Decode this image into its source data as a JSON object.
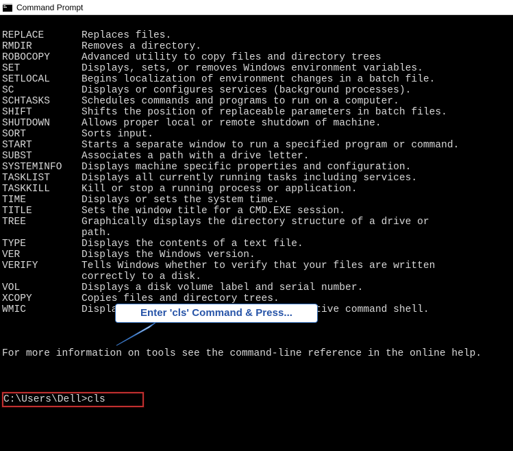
{
  "window": {
    "title": "Command Prompt"
  },
  "commands": [
    {
      "name": "REPLACE",
      "desc": "Replaces files."
    },
    {
      "name": "RMDIR",
      "desc": "Removes a directory."
    },
    {
      "name": "ROBOCOPY",
      "desc": "Advanced utility to copy files and directory trees"
    },
    {
      "name": "SET",
      "desc": "Displays, sets, or removes Windows environment variables."
    },
    {
      "name": "SETLOCAL",
      "desc": "Begins localization of environment changes in a batch file."
    },
    {
      "name": "SC",
      "desc": "Displays or configures services (background processes)."
    },
    {
      "name": "SCHTASKS",
      "desc": "Schedules commands and programs to run on a computer."
    },
    {
      "name": "SHIFT",
      "desc": "Shifts the position of replaceable parameters in batch files."
    },
    {
      "name": "SHUTDOWN",
      "desc": "Allows proper local or remote shutdown of machine."
    },
    {
      "name": "SORT",
      "desc": "Sorts input."
    },
    {
      "name": "START",
      "desc": "Starts a separate window to run a specified program or command."
    },
    {
      "name": "SUBST",
      "desc": "Associates a path with a drive letter."
    },
    {
      "name": "SYSTEMINFO",
      "desc": "Displays machine specific properties and configuration."
    },
    {
      "name": "TASKLIST",
      "desc": "Displays all currently running tasks including services."
    },
    {
      "name": "TASKKILL",
      "desc": "Kill or stop a running process or application."
    },
    {
      "name": "TIME",
      "desc": "Displays or sets the system time."
    },
    {
      "name": "TITLE",
      "desc": "Sets the window title for a CMD.EXE session."
    },
    {
      "name": "TREE",
      "desc": "Graphically displays the directory structure of a drive or",
      "cont": "path."
    },
    {
      "name": "TYPE",
      "desc": "Displays the contents of a text file."
    },
    {
      "name": "VER",
      "desc": "Displays the Windows version."
    },
    {
      "name": "VERIFY",
      "desc": "Tells Windows whether to verify that your files are written",
      "cont": "correctly to a disk."
    },
    {
      "name": "VOL",
      "desc": "Displays a disk volume label and serial number."
    },
    {
      "name": "XCOPY",
      "desc": "Copies files and directory trees."
    },
    {
      "name": "WMIC",
      "desc": "Displays WMI information inside interactive command shell."
    }
  ],
  "footer": "For more information on tools see the command-line reference in the online help.",
  "prompt": {
    "path": "C:\\Users\\Dell>",
    "entered": "cls"
  },
  "callout": {
    "text": "Enter 'cls' Command & Press..."
  }
}
